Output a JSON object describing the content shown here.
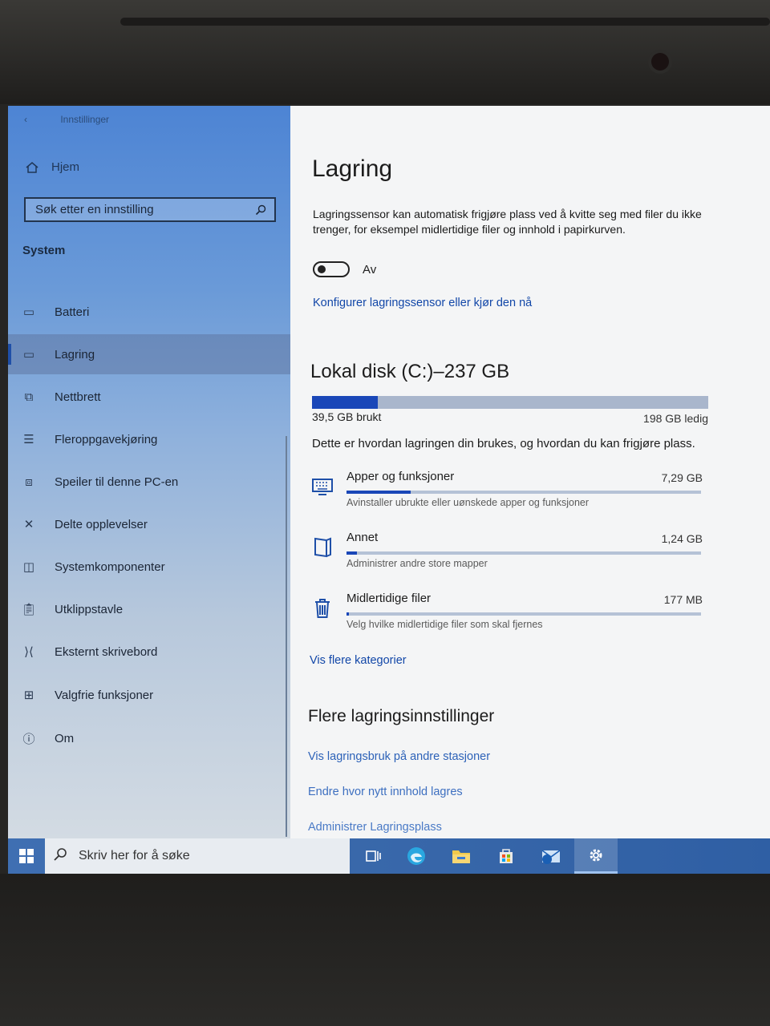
{
  "window": {
    "title": "Innstillinger",
    "back_glyph": "‹"
  },
  "sidebar": {
    "home_label": "Hjem",
    "search_placeholder": "Søk etter en innstilling",
    "section": "System",
    "items": [
      {
        "label": "Batteri",
        "icon": "battery-icon"
      },
      {
        "label": "Lagring",
        "icon": "storage-icon",
        "active": true
      },
      {
        "label": "Nettbrett",
        "icon": "tablet-icon"
      },
      {
        "label": "Fleroppgavekjøring",
        "icon": "multitasking-icon"
      },
      {
        "label": "Speiler til denne PC-en",
        "icon": "projecting-icon"
      },
      {
        "label": "Delte opplevelser",
        "icon": "shared-experiences-icon"
      },
      {
        "label": "Systemkomponenter",
        "icon": "system-components-icon"
      },
      {
        "label": "Utklippstavle",
        "icon": "clipboard-icon"
      },
      {
        "label": "Eksternt skrivebord",
        "icon": "remote-desktop-icon"
      },
      {
        "label": "Valgfrie funksjoner",
        "icon": "optional-features-icon"
      },
      {
        "label": "Om",
        "icon": "info-icon"
      }
    ]
  },
  "main": {
    "title": "Lagring",
    "description": "Lagringssensor kan automatisk frigjøre plass ved å kvitte seg med filer du ikke trenger, for eksempel midlertidige filer og innhold i papirkurven.",
    "toggle_label": "Av",
    "configure_link": "Konfigurer lagringssensor eller kjør den nå",
    "disk": {
      "title": "Lokal disk (C:)–237 GB",
      "used_fraction": 0.165,
      "used_label": "39,5 GB brukt",
      "free_label": "198 GB ledig",
      "description": "Dette er hvordan lagringen din brukes, og hvordan du kan frigjøre plass."
    },
    "categories": [
      {
        "name": "Apper og funksjoner",
        "size": "7,29 GB",
        "sub": "Avinstaller ubrukte eller uønskede apper og funksjoner",
        "fraction": 0.18,
        "icon": "apps-icon"
      },
      {
        "name": "Annet",
        "size": "1,24 GB",
        "sub": "Administrer andre store mapper",
        "fraction": 0.03,
        "icon": "other-icon"
      },
      {
        "name": "Midlertidige filer",
        "size": "177 MB",
        "sub": "Velg hvilke midlertidige filer som skal fjernes",
        "fraction": 0.005,
        "icon": "trash-icon"
      }
    ],
    "more_categories_link": "Vis flere kategorier",
    "more_settings": {
      "title": "Flere lagringsinnstillinger",
      "links": [
        "Vis lagringsbruk på andre stasjoner",
        "Endre hvor nytt innhold lagres",
        "Administrer Lagringsplass"
      ]
    }
  },
  "taskbar": {
    "search_placeholder": "Skriv her for å søke",
    "icons": [
      "task-view-icon",
      "edge-icon",
      "file-explorer-icon",
      "store-icon",
      "mail-icon",
      "settings-icon"
    ]
  }
}
